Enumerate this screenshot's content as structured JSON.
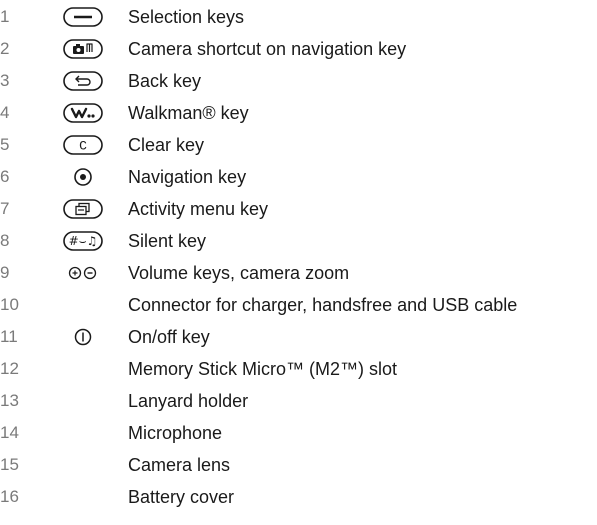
{
  "items": [
    {
      "number": "1",
      "label": "Selection keys",
      "icon": "selection-key-icon"
    },
    {
      "number": "2",
      "label": "Camera shortcut on navigation key",
      "icon": "camera-icon"
    },
    {
      "number": "3",
      "label": "Back key",
      "icon": "back-key-icon"
    },
    {
      "number": "4",
      "label": "Walkman® key",
      "icon": "walkman-icon"
    },
    {
      "number": "5",
      "label": "Clear key",
      "icon": "clear-key-icon"
    },
    {
      "number": "6",
      "label": "Navigation key",
      "icon": "navigation-key-icon"
    },
    {
      "number": "7",
      "label": "Activity menu key",
      "icon": "activity-menu-icon"
    },
    {
      "number": "8",
      "label": "Silent key",
      "icon": "silent-key-icon"
    },
    {
      "number": "9",
      "label": "Volume keys, camera zoom",
      "icon": "volume-keys-icon"
    },
    {
      "number": "10",
      "label": "Connector for charger, handsfree and USB cable",
      "icon": ""
    },
    {
      "number": "11",
      "label": "On/off key",
      "icon": "power-icon"
    },
    {
      "number": "12",
      "label": "Memory Stick Micro™ (M2™) slot",
      "icon": ""
    },
    {
      "number": "13",
      "label": "Lanyard holder",
      "icon": ""
    },
    {
      "number": "14",
      "label": "Microphone",
      "icon": ""
    },
    {
      "number": "15",
      "label": "Camera lens",
      "icon": ""
    },
    {
      "number": "16",
      "label": "Battery cover",
      "icon": ""
    }
  ],
  "key_glyphs": {
    "clear": "C",
    "silent": "#⌣♫"
  }
}
